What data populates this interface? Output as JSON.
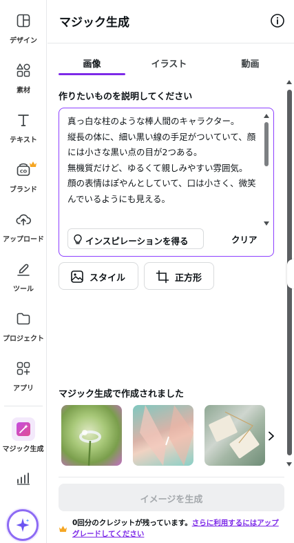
{
  "rail": {
    "items": [
      {
        "label": "デザイン",
        "icon": "layout-icon"
      },
      {
        "label": "素材",
        "icon": "elements-icon"
      },
      {
        "label": "テキスト",
        "icon": "text-icon"
      },
      {
        "label": "ブランド",
        "icon": "brand-icon"
      },
      {
        "label": "アップロード",
        "icon": "upload-cloud-icon"
      },
      {
        "label": "ツール",
        "icon": "draw-tool-icon"
      },
      {
        "label": "プロジェクト",
        "icon": "folder-icon"
      },
      {
        "label": "アプリ",
        "icon": "apps-icon"
      },
      {
        "label": "マジック生成",
        "icon": "magic-media-icon"
      }
    ],
    "accent": "#8b3dff",
    "crown_color": "#f5a623"
  },
  "panel": {
    "title": "マジック生成",
    "tabs": [
      {
        "label": "画像",
        "active": true
      },
      {
        "label": "イラスト",
        "active": false
      },
      {
        "label": "動画",
        "active": false
      }
    ],
    "prompt_label": "作りたいものを説明してください",
    "prompt_text": "真っ白な柱のような棒人間のキャラクター。\n縦長の体に、細い黒い線の手足がついていて、顔には小さな黒い点の目が2つある。\n無機質だけど、ゆるくて親しみやすい雰囲気。\n顔の表情はぽやんとしていて、口は小さく、微笑んでいるようにも見える。",
    "inspire_label": "インスピレーションを得る",
    "clear_label": "クリア",
    "style_label": "スタイル",
    "ratio_label": "正方形",
    "gallery_label": "マジック生成で作成されました",
    "generate_label": "イメージを生成",
    "credit_text": "0回分のクレジットが残っています。",
    "upgrade_link": "さらに利用するにはアップグレードしてください"
  }
}
